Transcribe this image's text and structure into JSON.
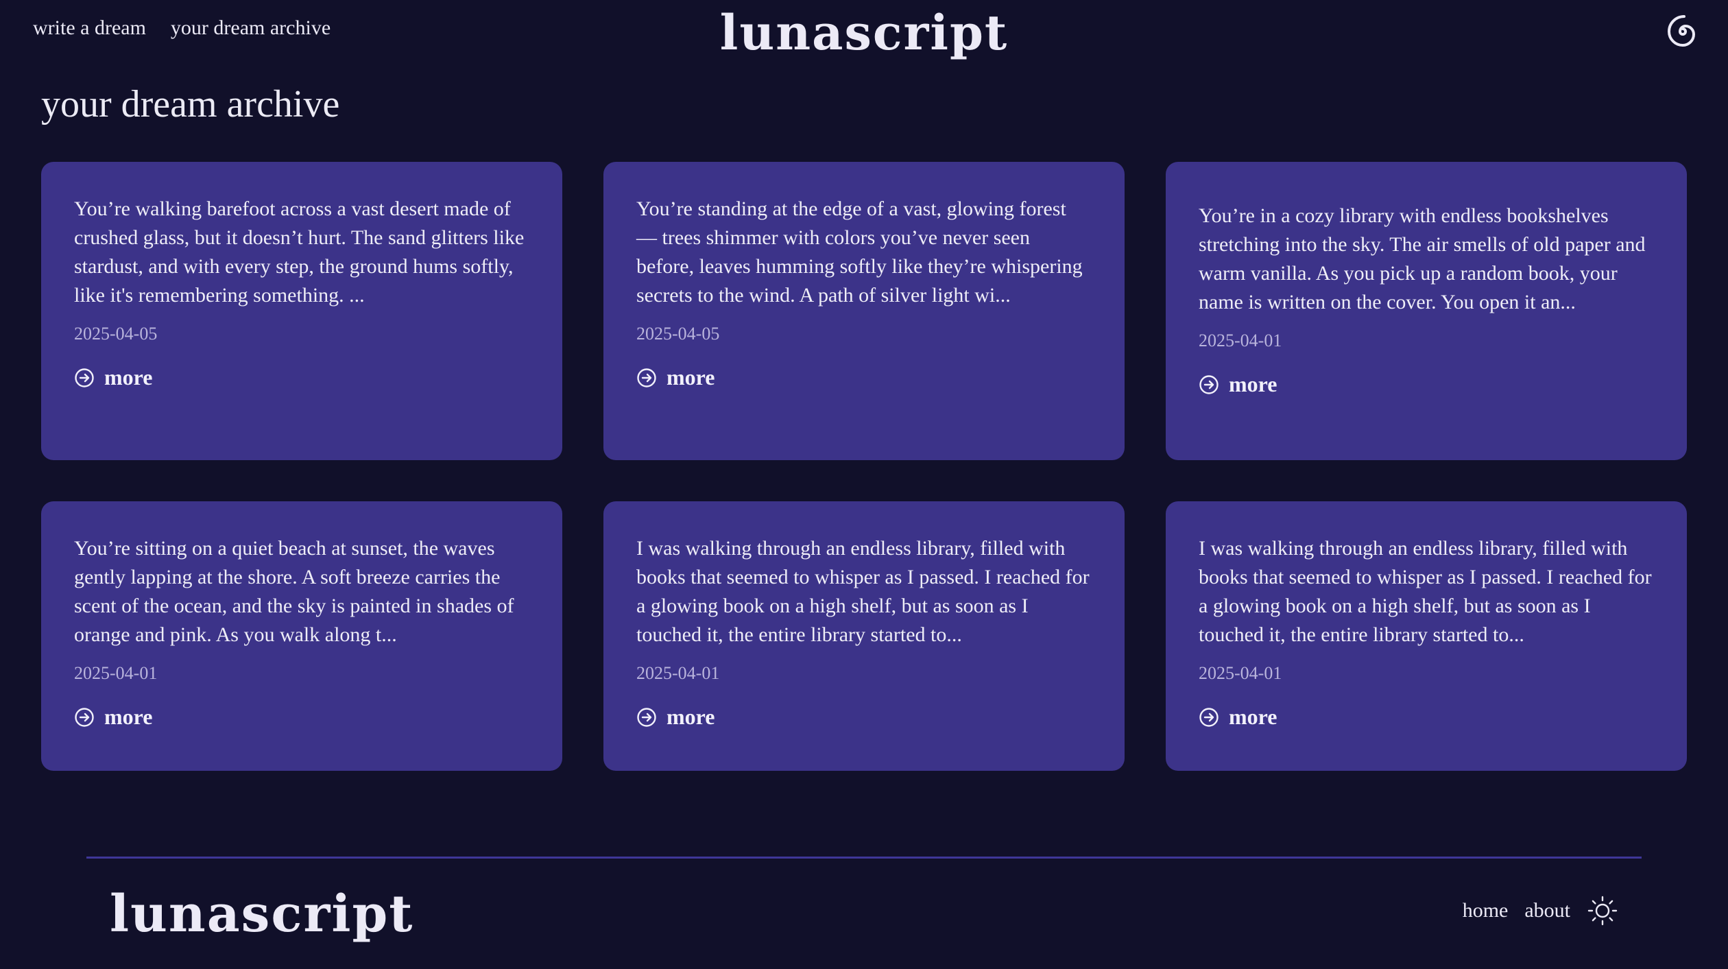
{
  "nav": {
    "write_label": "write a dream",
    "archive_label": "your dream archive"
  },
  "brand": {
    "name": "lunascript"
  },
  "page_title": "your dream archive",
  "cards": [
    {
      "excerpt": "You’re walking barefoot across a vast desert made of crushed glass, but it doesn’t hurt. The sand glitters like stardust, and with every step, the ground hums softly, like it's remembering something. ...",
      "date": "2025-04-05",
      "more_label": "more"
    },
    {
      "excerpt": "You’re standing at the edge of a vast, glowing forest — trees shimmer with colors you’ve never seen before, leaves humming softly like they’re whispering secrets to the wind. A path of silver light wi...",
      "date": "2025-04-05",
      "more_label": "more"
    },
    {
      "excerpt": "You’re in a cozy library with endless bookshelves stretching into the sky. The air smells of old paper and warm vanilla. As you pick up a random book, your name is written on the cover. You open it an...",
      "date": "2025-04-01",
      "more_label": "more"
    },
    {
      "excerpt": "You’re sitting on a quiet beach at sunset, the waves gently lapping at the shore. A soft breeze carries the scent of the ocean, and the sky is painted in shades of orange and pink. As you walk along t...",
      "date": "2025-04-01",
      "more_label": "more"
    },
    {
      "excerpt": "I was walking through an endless library, filled with books that seemed to whisper as I passed. I reached for a glowing book on a high shelf, but as soon as I touched it, the entire library started to...",
      "date": "2025-04-01",
      "more_label": "more"
    },
    {
      "excerpt": "I was walking through an endless library, filled with books that seemed to whisper as I passed. I reached for a glowing book on a high shelf, but as soon as I touched it, the entire library started to...",
      "date": "2025-04-01",
      "more_label": "more"
    }
  ],
  "footer": {
    "home_label": "home",
    "about_label": "about"
  },
  "icons": {
    "top_right": "spiral-icon",
    "more": "arrow-circle-right-icon",
    "theme_toggle": "sun-icon"
  },
  "colors": {
    "background": "#11102a",
    "card": "#3c3389",
    "divider": "#3f3697",
    "text": "#eceaf6"
  }
}
